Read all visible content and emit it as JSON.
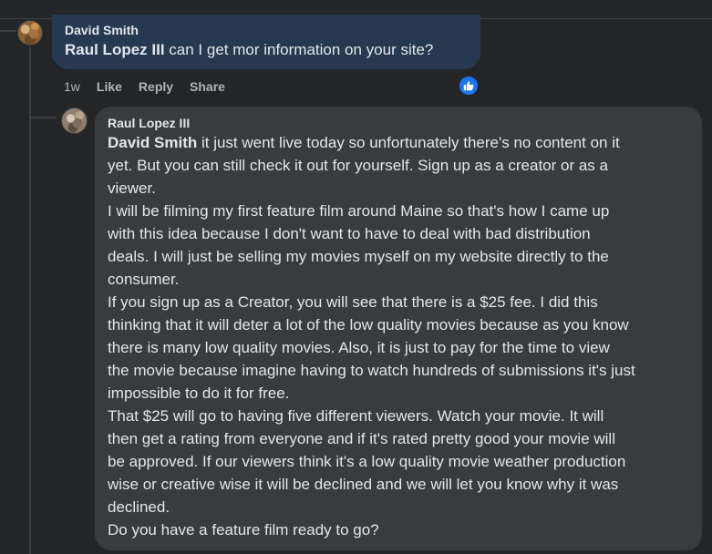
{
  "top_comment": {
    "author": "David Smith",
    "mention": "Raul Lopez III",
    "text": " can I get mor information on your site?",
    "age": "1w",
    "actions": {
      "like": "Like",
      "reply": "Reply",
      "share": "Share"
    },
    "reaction_icon": "thumbs-up-icon",
    "accent": "#263951"
  },
  "reply": {
    "author": "Raul Lopez III",
    "mention": "David Smith",
    "lines": [
      " it just went live today so unfortunately there's no content on it",
      "yet. But you can still check it out for yourself. Sign up as a creator or as a",
      "viewer.",
      "I will be filming my first feature film around Maine so that's how I came up",
      "with this idea because I don't want to have to deal with bad distribution",
      "deals. I will just be selling my movies myself on my website directly to the",
      "consumer.",
      "If you sign up as a Creator, you will see that there is a $25 fee. I did this",
      "thinking that it will deter a lot of the low quality movies because as you know",
      "there is many low quality movies. Also, it is just to pay for the time to view",
      "the movie because imagine having to watch hundreds of submissions it's just",
      "impossible to do it for free.",
      "That $25 will go to having five different viewers. Watch your movie. It will",
      "then get a rating from everyone and if it's rated pretty good your movie will",
      "be approved. If our viewers think it's a low quality movie weather production",
      "wise or creative wise it will be declined and we will let you know why it was",
      "declined.",
      "Do you have a feature film ready to go?"
    ]
  },
  "colors": {
    "background": "#242526",
    "reply_bubble": "#3a3b3c",
    "like_badge": "#1a77f2",
    "secondary_text": "#b0b3b8"
  }
}
